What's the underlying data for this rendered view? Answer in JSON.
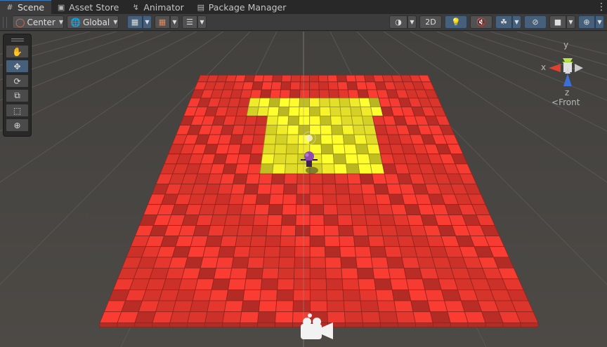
{
  "tabs": [
    {
      "label": "Scene",
      "icon": "grid-icon",
      "active": true
    },
    {
      "label": "Asset Store",
      "icon": "bag-icon",
      "active": false
    },
    {
      "label": "Animator",
      "icon": "animator-icon",
      "active": false
    },
    {
      "label": "Package Manager",
      "icon": "package-icon",
      "active": false
    }
  ],
  "toolbar": {
    "pivot": "Center",
    "space": "Global",
    "mode_2d": "2D"
  },
  "tools": [
    "hand-tool",
    "move-tool",
    "rotate-tool",
    "scale-tool",
    "rect-tool",
    "transform-tool"
  ],
  "gizmo": {
    "x_label": "x",
    "y_label": "y",
    "z_label": "z",
    "view_label": "Front",
    "view_prefix": "<"
  },
  "colors": {
    "accent": "#3a79bb",
    "floor_red": "#e8382f",
    "floor_yellow": "#f2ee2b",
    "background": "#4a4743"
  },
  "grid": {
    "rows": 25,
    "cols": 25,
    "yellow_region": {
      "top_band_rows": [
        3,
        4
      ],
      "top_band_cols": [
        6,
        18
      ],
      "body_rows": [
        5,
        10
      ],
      "body_cols": [
        8,
        17
      ]
    }
  }
}
